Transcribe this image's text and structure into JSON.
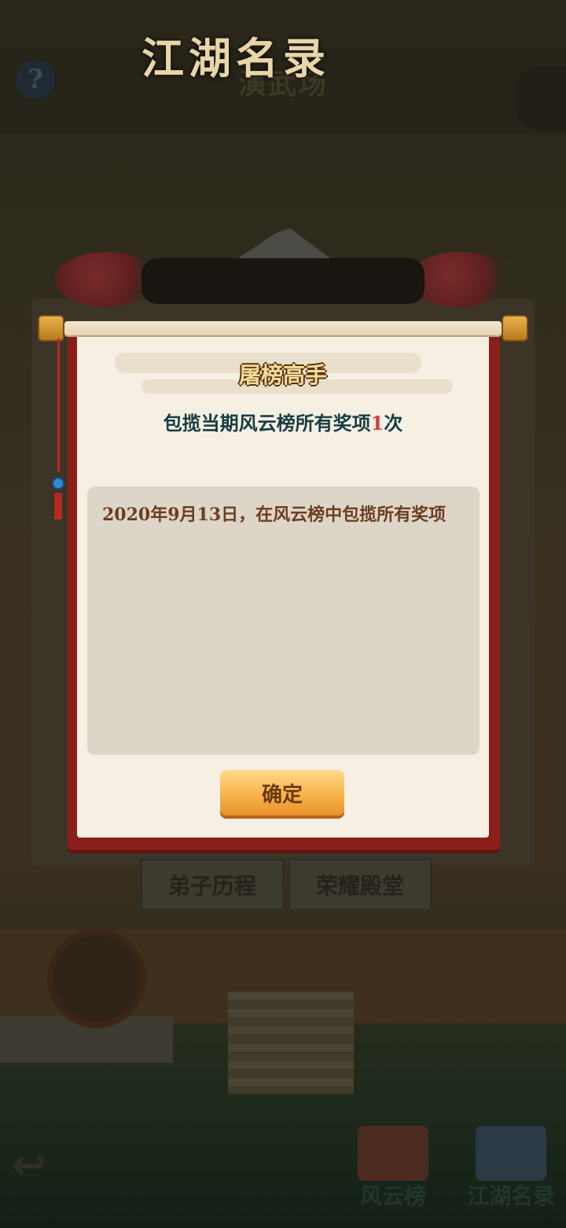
{
  "scene": {
    "title": "演武场",
    "help_glyph": "?",
    "tabs": [
      "弟子历程",
      "荣耀殿堂"
    ],
    "bottom_buttons": [
      "风云榜",
      "江湖名录"
    ],
    "back_glyph": "↩"
  },
  "dialog": {
    "banner_title": "江湖名录",
    "achievement_title": "屠榜高手",
    "description_prefix": "包揽当期风云榜所有奖项",
    "description_count": "1",
    "description_suffix": "次",
    "records": [
      "2020年9月13日，在风云榜中包揽所有奖项"
    ],
    "confirm_label": "确定"
  },
  "colors": {
    "scroll_frame": "#8a1f1a",
    "paper": "#f5efe4",
    "record_box": "#ddd5c7",
    "count_highlight": "#d2403a",
    "button": "#f7b44a"
  }
}
